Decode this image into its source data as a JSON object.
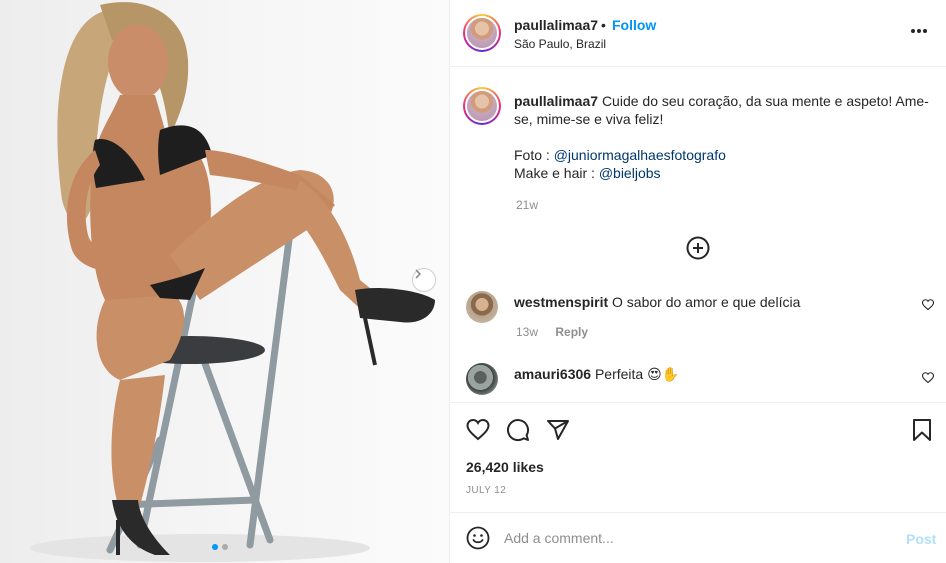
{
  "post": {
    "image_alt": "Woman in black bikini seated on a gray bar stool",
    "carousel_dots": 2,
    "active_dot": 0
  },
  "header": {
    "username": "paullalimaa7",
    "separator": "•",
    "follow_label": "Follow",
    "location": "São Paulo, Brazil"
  },
  "caption": {
    "username": "paullalimaa7",
    "text": "Cuide do seu coração, da sua mente e aspeto! Ame-se, mime-se e viva feliz!",
    "photo_prefix": "Foto : ",
    "photo_handle": "@juniormagalhaesfotografo",
    "makeup_prefix": "Make e hair : ",
    "makeup_handle": "@bieljobs",
    "age": "21w"
  },
  "comments": [
    {
      "username": "westmenspirit",
      "text": "O sabor do amor e que delícia",
      "age": "13w",
      "reply_label": "Reply"
    },
    {
      "username": "amauri6306",
      "text": "Perfeita 😍✋"
    }
  ],
  "stats": {
    "likes": "26,420 likes",
    "date": "JULY 12"
  },
  "add_comment": {
    "placeholder": "Add a comment...",
    "post_label": "Post"
  },
  "icons": {
    "more": "more-horizontal-icon",
    "next": "chevron-right-icon",
    "add": "plus-circle-icon",
    "like": "heart-icon",
    "comment": "comment-icon",
    "share": "send-icon",
    "save": "bookmark-icon",
    "emoji": "emoji-icon"
  },
  "colors": {
    "accent": "#0095f6",
    "link": "#00376b",
    "muted": "#8e8e8e",
    "text": "#262626",
    "border": "#efefef"
  }
}
